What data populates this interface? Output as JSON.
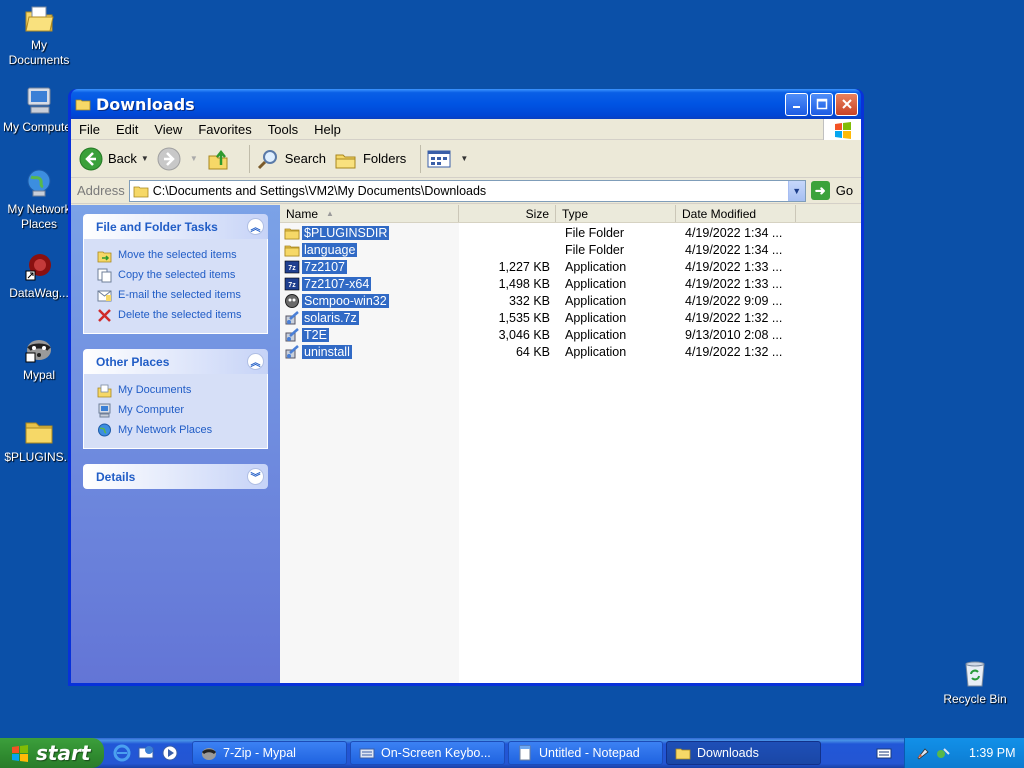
{
  "desktop": {
    "icons": [
      {
        "label": "My Documents"
      },
      {
        "label": "My Computer"
      },
      {
        "label": "My Network Places"
      },
      {
        "label": "DataWag..."
      },
      {
        "label": "Mypal"
      },
      {
        "label": "$PLUGINS..."
      },
      {
        "label": "Recycle Bin"
      }
    ]
  },
  "window": {
    "title": "Downloads",
    "menu": [
      "File",
      "Edit",
      "View",
      "Favorites",
      "Tools",
      "Help"
    ],
    "toolbar": {
      "back": "Back",
      "search": "Search",
      "folders": "Folders"
    },
    "address": {
      "label": "Address",
      "value": "C:\\Documents and Settings\\VM2\\My Documents\\Downloads",
      "go": "Go"
    },
    "taskpane": {
      "file_tasks": {
        "title": "File and Folder Tasks",
        "links": [
          "Move the selected items",
          "Copy the selected items",
          "E-mail the selected items",
          "Delete the selected items"
        ]
      },
      "other_places": {
        "title": "Other Places",
        "links": [
          "My Documents",
          "My Computer",
          "My Network Places"
        ]
      },
      "details": {
        "title": "Details"
      }
    },
    "columns": {
      "name": "Name",
      "size": "Size",
      "type": "Type",
      "date": "Date Modified"
    },
    "files": [
      {
        "name": "$PLUGINSDIR",
        "size": "",
        "type": "File Folder",
        "date": "4/19/2022 1:34 ...",
        "icon": "folder-icon"
      },
      {
        "name": "language",
        "size": "",
        "type": "File Folder",
        "date": "4/19/2022 1:34 ...",
        "icon": "folder-icon"
      },
      {
        "name": "7z2107",
        "size": "1,227 KB",
        "type": "Application",
        "date": "4/19/2022 1:33 ...",
        "icon": "7zip-icon"
      },
      {
        "name": "7z2107-x64",
        "size": "1,498 KB",
        "type": "Application",
        "date": "4/19/2022 1:33 ...",
        "icon": "7zip-icon"
      },
      {
        "name": "Scmpoo-win32",
        "size": "332 KB",
        "type": "Application",
        "date": "4/19/2022 9:09 ...",
        "icon": "app-icon"
      },
      {
        "name": "solaris.7z",
        "size": "1,535 KB",
        "type": "Application",
        "date": "4/19/2022 1:32 ...",
        "icon": "installer-icon"
      },
      {
        "name": "T2E",
        "size": "3,046 KB",
        "type": "Application",
        "date": "9/13/2010 2:08 ...",
        "icon": "installer-icon"
      },
      {
        "name": "uninstall",
        "size": "64 KB",
        "type": "Application",
        "date": "4/19/2022 1:32 ...",
        "icon": "installer-icon"
      }
    ]
  },
  "taskbar": {
    "start": "start",
    "tasks": [
      {
        "label": "7-Zip - Mypal"
      },
      {
        "label": "On-Screen Keybo..."
      },
      {
        "label": "Untitled - Notepad"
      },
      {
        "label": "Downloads"
      }
    ],
    "clock": "1:39 PM"
  }
}
